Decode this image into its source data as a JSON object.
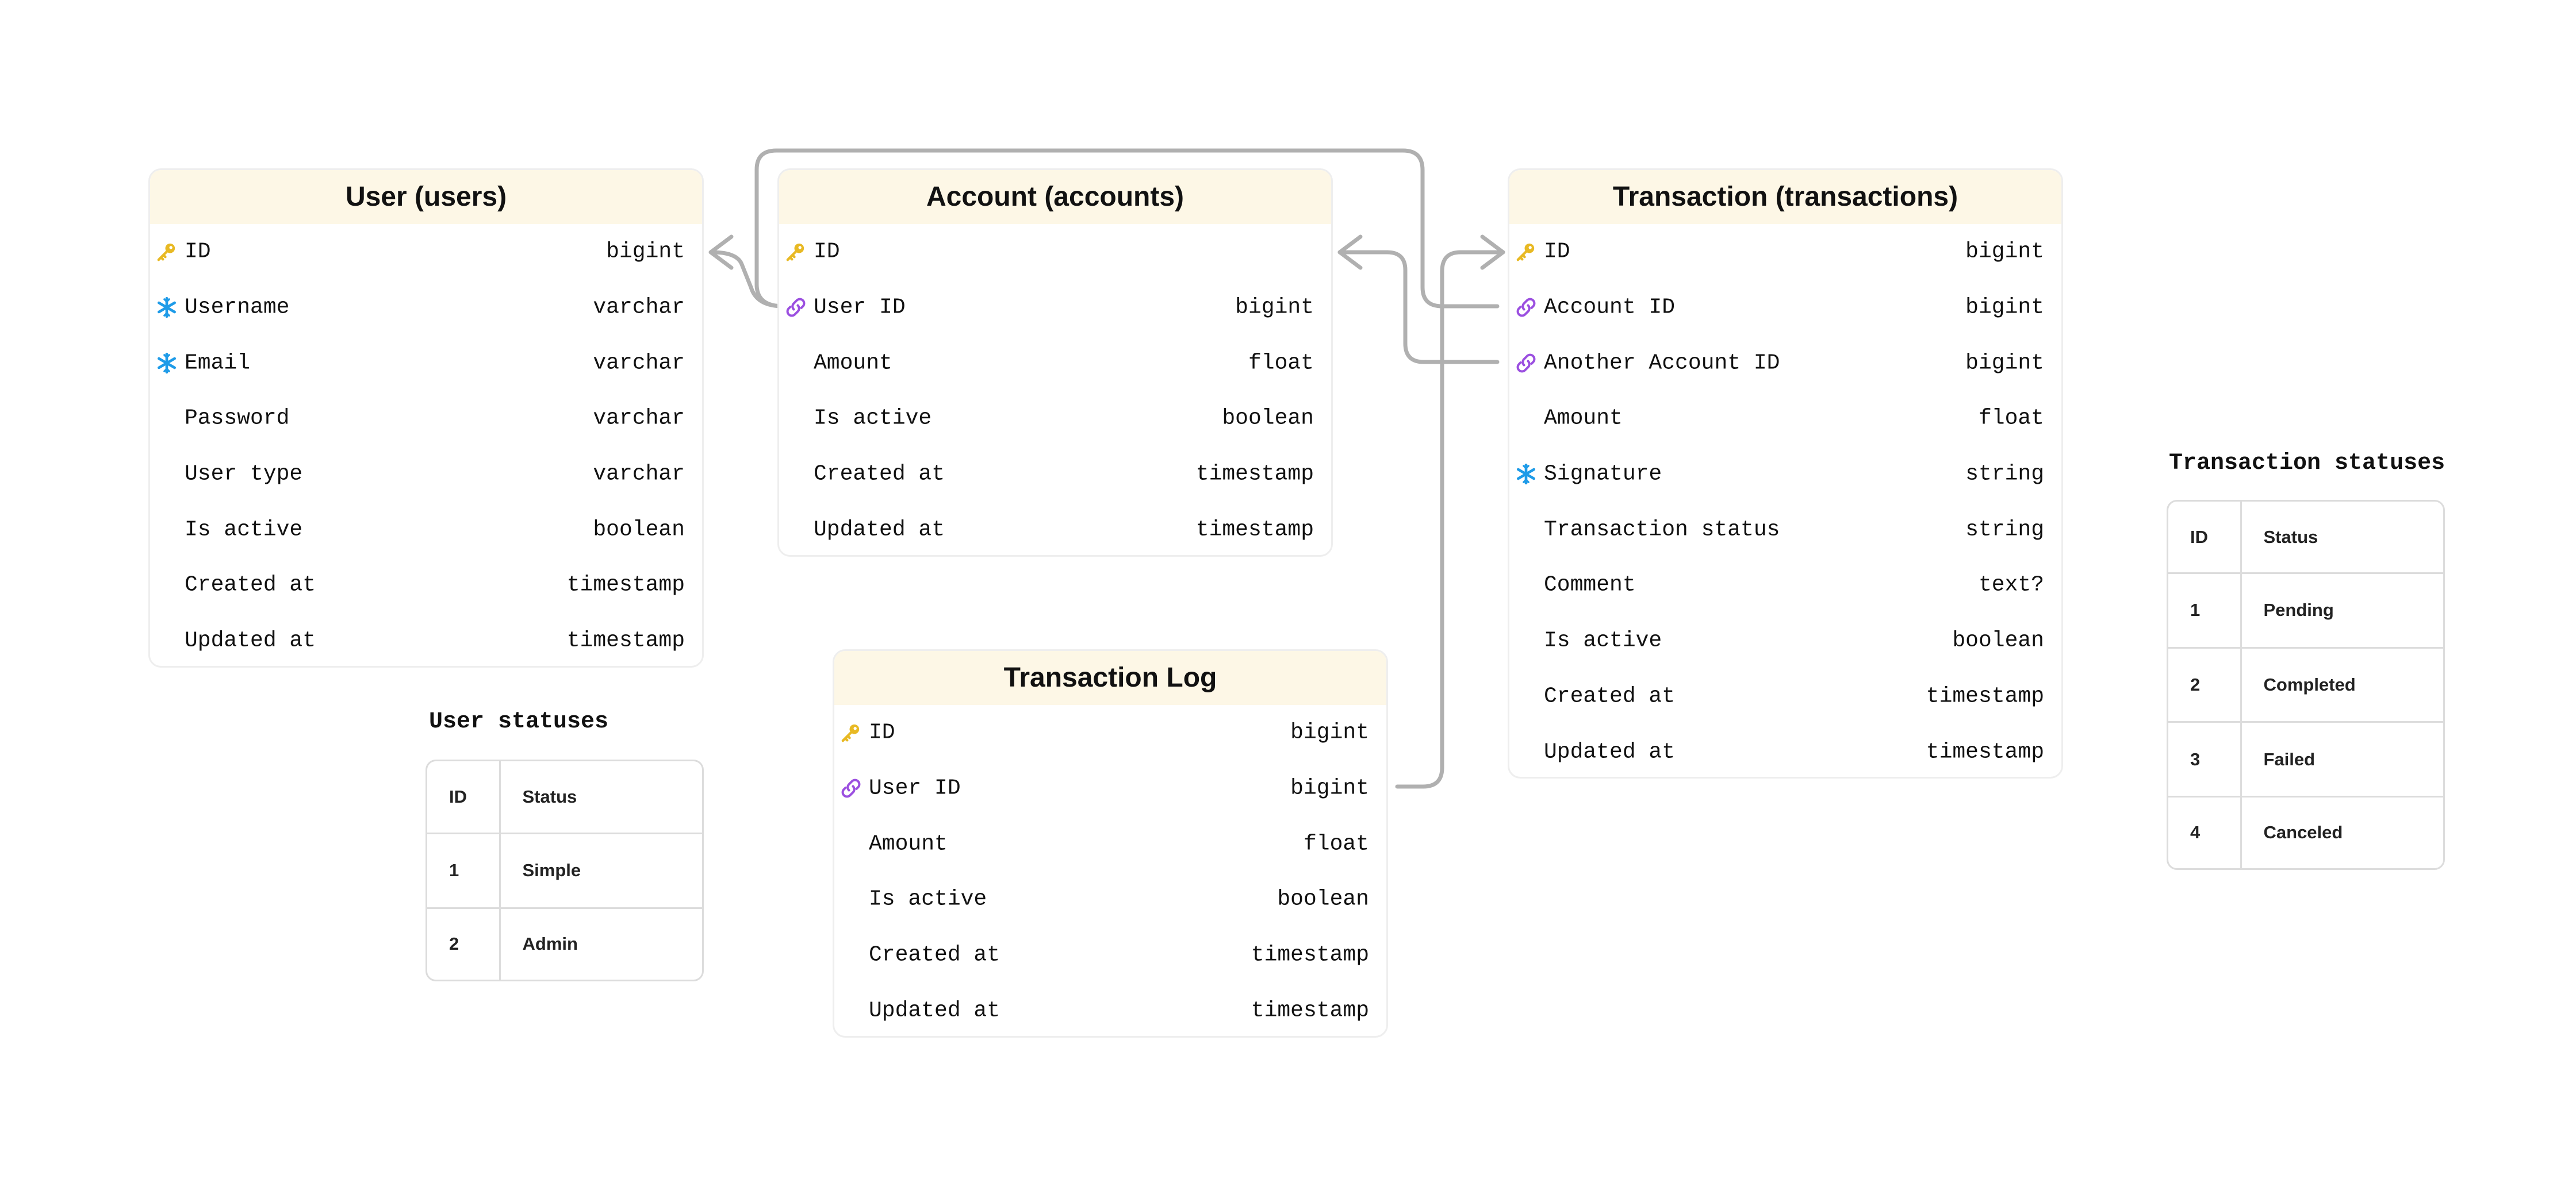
{
  "entities": {
    "users": {
      "title": "User (users)",
      "fields": [
        {
          "name": "ID",
          "type": "bigint",
          "icon": "key-icon"
        },
        {
          "name": "Username",
          "type": "varchar",
          "icon": "unique-icon"
        },
        {
          "name": "Email",
          "type": "varchar",
          "icon": "unique-icon"
        },
        {
          "name": "Password",
          "type": "varchar",
          "icon": ""
        },
        {
          "name": "User type",
          "type": "varchar",
          "icon": ""
        },
        {
          "name": "Is active",
          "type": "boolean",
          "icon": ""
        },
        {
          "name": "Created at",
          "type": "timestamp",
          "icon": ""
        },
        {
          "name": "Updated at",
          "type": "timestamp",
          "icon": ""
        }
      ]
    },
    "accounts": {
      "title": "Account (accounts)",
      "fields": [
        {
          "name": "ID",
          "type": "",
          "icon": "key-icon"
        },
        {
          "name": "User ID",
          "type": "bigint",
          "icon": "link-icon"
        },
        {
          "name": "Amount",
          "type": "float",
          "icon": ""
        },
        {
          "name": "Is active",
          "type": "boolean",
          "icon": ""
        },
        {
          "name": "Created at",
          "type": "timestamp",
          "icon": ""
        },
        {
          "name": "Updated at",
          "type": "timestamp",
          "icon": ""
        }
      ]
    },
    "transactions": {
      "title": "Transaction (transactions)",
      "fields": [
        {
          "name": "ID",
          "type": "bigint",
          "icon": "key-icon"
        },
        {
          "name": "Account ID",
          "type": "bigint",
          "icon": "link-icon"
        },
        {
          "name": "Another Account ID",
          "type": "bigint",
          "icon": "link-icon"
        },
        {
          "name": "Amount",
          "type": "float",
          "icon": ""
        },
        {
          "name": "Signature",
          "type": "string",
          "icon": "unique-icon"
        },
        {
          "name": "Transaction status",
          "type": "string",
          "icon": ""
        },
        {
          "name": "Comment",
          "type": "text?",
          "icon": ""
        },
        {
          "name": "Is active",
          "type": "boolean",
          "icon": ""
        },
        {
          "name": "Created at",
          "type": "timestamp",
          "icon": ""
        },
        {
          "name": "Updated at",
          "type": "timestamp",
          "icon": ""
        }
      ]
    },
    "transaction_log": {
      "title": "Transaction Log",
      "fields": [
        {
          "name": "ID",
          "type": "bigint",
          "icon": "key-icon"
        },
        {
          "name": "User ID",
          "type": "bigint",
          "icon": "link-icon"
        },
        {
          "name": "Amount",
          "type": "float",
          "icon": ""
        },
        {
          "name": "Is active",
          "type": "boolean",
          "icon": ""
        },
        {
          "name": "Created at",
          "type": "timestamp",
          "icon": ""
        },
        {
          "name": "Updated at",
          "type": "timestamp",
          "icon": ""
        }
      ]
    }
  },
  "lookups": {
    "user_statuses": {
      "title": "User statuses",
      "columns": [
        "ID",
        "Status"
      ],
      "rows": [
        [
          "1",
          "Simple"
        ],
        [
          "2",
          "Admin"
        ]
      ]
    },
    "transaction_statuses": {
      "title": "Transaction statuses",
      "columns": [
        "ID",
        "Status"
      ],
      "rows": [
        [
          "1",
          "Pending"
        ],
        [
          "2",
          "Completed"
        ],
        [
          "3",
          "Failed"
        ],
        [
          "4",
          "Canceled"
        ]
      ]
    }
  },
  "colors": {
    "header_background": "#fdf7e6",
    "connector": "#b0b0b0",
    "key_icon": "#e8b923",
    "link_icon": "#9b4fe0",
    "unique_icon": "#1e9be8"
  }
}
